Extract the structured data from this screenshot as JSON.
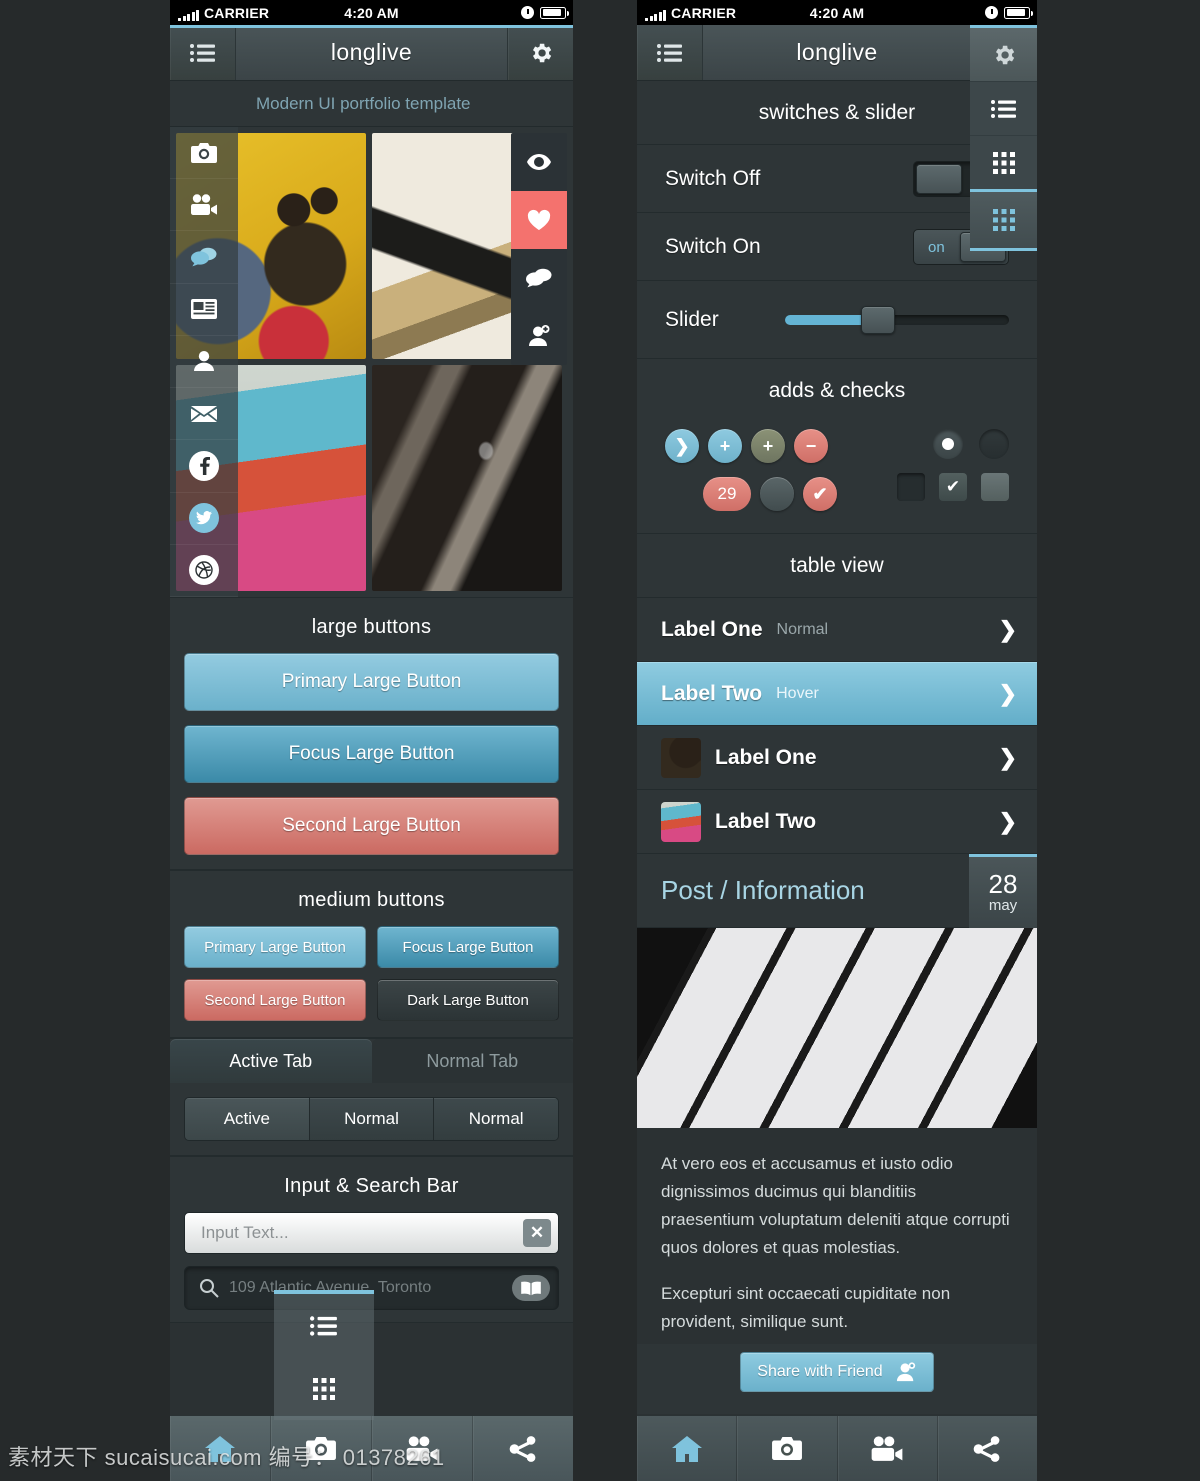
{
  "statusbar": {
    "carrier": "CARRIER",
    "time": "4:20 AM"
  },
  "left_phone": {
    "navbar": {
      "title": "longlive",
      "menu_icon": "list-icon",
      "gear_icon": "gear-icon"
    },
    "subtitle": "Modern UI portfolio template",
    "drawer": {
      "items": [
        {
          "icon": "camera-icon",
          "name": "camera"
        },
        {
          "icon": "video-camera-icon",
          "name": "video"
        },
        {
          "icon": "chat-bubbles-icon",
          "name": "chat"
        },
        {
          "icon": "news-icon",
          "name": "news"
        },
        {
          "icon": "user-icon",
          "name": "profile"
        },
        {
          "icon": "mail-icon",
          "name": "mail"
        }
      ],
      "social": [
        {
          "icon": "facebook-icon",
          "label": "f"
        },
        {
          "icon": "twitter-icon",
          "label": "t"
        },
        {
          "icon": "dribbble-icon",
          "label": "d"
        }
      ]
    },
    "rail": [
      {
        "icon": "eye-icon",
        "active": false
      },
      {
        "icon": "heart-icon",
        "active": true
      },
      {
        "icon": "chat-bubbles-icon",
        "active": false
      },
      {
        "icon": "add-user-icon",
        "active": false
      }
    ],
    "sections": {
      "large_buttons_title": "large buttons",
      "medium_buttons_title": "medium buttons",
      "input_title": "Input & Search Bar"
    },
    "large_buttons": [
      {
        "label": "Primary Large Button",
        "style": "primary"
      },
      {
        "label": "Focus Large Button",
        "style": "focus"
      },
      {
        "label": "Second Large Button",
        "style": "second"
      }
    ],
    "medium_buttons": [
      {
        "label": "Primary Large Button",
        "style": "primary"
      },
      {
        "label": "Focus Large Button",
        "style": "focus"
      },
      {
        "label": "Second Large Button",
        "style": "second"
      },
      {
        "label": "Dark Large Button",
        "style": "dark"
      }
    ],
    "tabs": [
      {
        "label": "Active Tab",
        "active": true
      },
      {
        "label": "Normal Tab",
        "active": false
      }
    ],
    "segments": [
      {
        "label": "Active",
        "active": true
      },
      {
        "label": "Normal",
        "active": false
      },
      {
        "label": "Normal",
        "active": false
      }
    ],
    "input": {
      "placeholder": "Input Text...",
      "clear_icon": "close-icon"
    },
    "search": {
      "icon": "search-icon",
      "placeholder": "109 Atlantic Avenue, Toronto",
      "action_icon": "book-icon"
    },
    "popup": [
      {
        "icon": "list-icon"
      },
      {
        "icon": "grid-icon"
      }
    ],
    "tabbar": [
      {
        "icon": "home-icon",
        "active": true
      },
      {
        "icon": "camera-icon",
        "active": false
      },
      {
        "icon": "video-camera-icon",
        "active": false
      },
      {
        "icon": "share-icon",
        "active": false
      }
    ]
  },
  "right_phone": {
    "navbar": {
      "title": "longlive",
      "menu_icon": "list-icon",
      "gear_icon": "gear-icon"
    },
    "dropdown": [
      {
        "icon": "gear-icon",
        "active": false
      },
      {
        "icon": "list-icon",
        "active": false
      },
      {
        "icon": "grid-icon",
        "active": false
      },
      {
        "icon": "grid-icon",
        "active": true
      }
    ],
    "switches_title": "switches & slider",
    "switch_off": {
      "label": "Switch Off",
      "state": "off",
      "state_text": ""
    },
    "switch_on": {
      "label": "Switch On",
      "state": "on",
      "state_text": "on"
    },
    "slider": {
      "label": "Slider",
      "value": 38,
      "min": 0,
      "max": 100
    },
    "adds_title": "adds & checks",
    "adds": [
      {
        "name": "chevron-right-button",
        "glyph": "❯",
        "color": "blue"
      },
      {
        "name": "plus-button-blue",
        "glyph": "+",
        "color": "blue"
      },
      {
        "name": "plus-button-olive",
        "glyph": "+",
        "color": "olive"
      },
      {
        "name": "minus-button-red",
        "glyph": "−",
        "color": "red"
      },
      {
        "name": "count-badge",
        "glyph": "29",
        "color": "red"
      },
      {
        "name": "blank-circle-button",
        "glyph": "",
        "color": "grey"
      },
      {
        "name": "check-button-red",
        "glyph": "✔",
        "color": "red"
      }
    ],
    "radios": [
      {
        "name": "radio-selected",
        "selected": true
      },
      {
        "name": "radio-empty",
        "selected": false
      }
    ],
    "checks": [
      {
        "name": "checkbox-dark",
        "checked": false,
        "style": "dark"
      },
      {
        "name": "checkbox-checked",
        "checked": true,
        "style": "mid"
      },
      {
        "name": "checkbox-light",
        "checked": false,
        "style": "lite"
      }
    ],
    "table_title": "table view",
    "table_rows": [
      {
        "label": "Label One",
        "sub": "Normal",
        "hover": false,
        "thumb": false
      },
      {
        "label": "Label Two",
        "sub": "Hover",
        "hover": true,
        "thumb": false
      },
      {
        "label": "Label One",
        "sub": "",
        "hover": false,
        "thumb": true,
        "thumb_kind": "smiley"
      },
      {
        "label": "Label Two",
        "sub": "",
        "hover": false,
        "thumb": true,
        "thumb_kind": "ticket"
      }
    ],
    "post": {
      "title": "Post / Information",
      "date_day": "28",
      "date_month": "may",
      "paragraph_1": "At vero eos et accusamus et iusto odio dignissimos ducimus qui blanditiis praesentium voluptatum deleniti atque corrupti quos dolores et quas molestias.",
      "paragraph_2": "Excepturi sint occaecati cupiditate non provident, similique sunt.",
      "share_label": "Share with Friend",
      "share_icon": "add-user-icon"
    },
    "tabbar": [
      {
        "icon": "home-icon",
        "active": true
      },
      {
        "icon": "camera-icon",
        "active": false
      },
      {
        "icon": "video-camera-icon",
        "active": false
      },
      {
        "icon": "share-icon",
        "active": false
      }
    ]
  },
  "watermark": "素材天下 sucaisucai.com  编号： 01378261",
  "colors": {
    "accent": "#7fc3dd",
    "danger": "#cf6f67",
    "bg": "#2e3537",
    "page_bg": "#262a2b"
  }
}
